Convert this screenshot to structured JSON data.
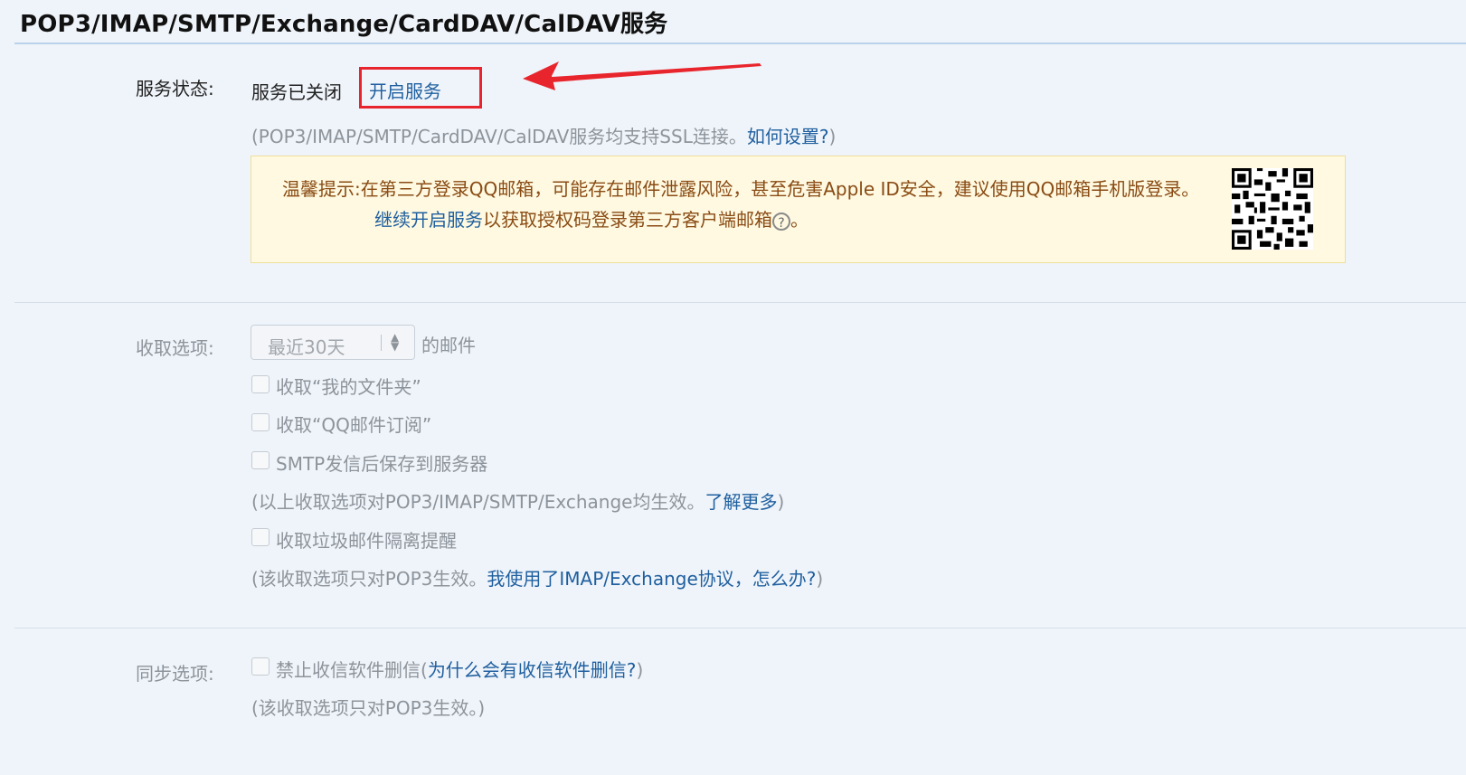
{
  "title": "POP3/IMAP/SMTP/Exchange/CardDAV/CalDAV服务",
  "service_status": {
    "label": "服务状态:",
    "value": "服务已关闭",
    "enable_link": "开启服务",
    "note_prefix": "(POP3/IMAP/SMTP/CardDAV/CalDAV服务均支持SSL连接。",
    "note_link": "如何设置?",
    "note_suffix": ")"
  },
  "tip": {
    "line1": "温馨提示:在第三方登录QQ邮箱，可能存在邮件泄露风险，甚至危害Apple ID安全，建议使用QQ邮箱手机版登录。",
    "line2_link": "继续开启服务",
    "line2_text": "以获取授权码登录第三方客户端邮箱",
    "line2_end": "。",
    "help_glyph": "?"
  },
  "receive_options": {
    "label": "收取选项:",
    "select_value": "最近30天",
    "select_suffix": "的邮件",
    "cb1": "收取“我的文件夹”",
    "cb2": "收取“QQ邮件订阅”",
    "cb3": "SMTP发信后保存到服务器",
    "note1_prefix": "(以上收取选项对POP3/IMAP/SMTP/Exchange均生效。",
    "note1_link": "了解更多",
    "note1_suffix": ")",
    "cb4": "收取垃圾邮件隔离提醒",
    "note2_prefix": "(该收取选项只对POP3生效。",
    "note2_link": "我使用了IMAP/Exchange协议，怎么办?",
    "note2_suffix": ")"
  },
  "sync_options": {
    "label": "同步选项:",
    "cb1": "禁止收信软件删信",
    "cb1_link_prefix": "(",
    "cb1_link": "为什么会有收信软件删信?",
    "cb1_link_suffix": ")",
    "note": "(该收取选项只对POP3生效。)"
  },
  "colors": {
    "link": "#1f5f9f",
    "highlight_box": "#e8252c",
    "tip_bg": "#fef9e0",
    "tip_text": "#8a4b14"
  }
}
